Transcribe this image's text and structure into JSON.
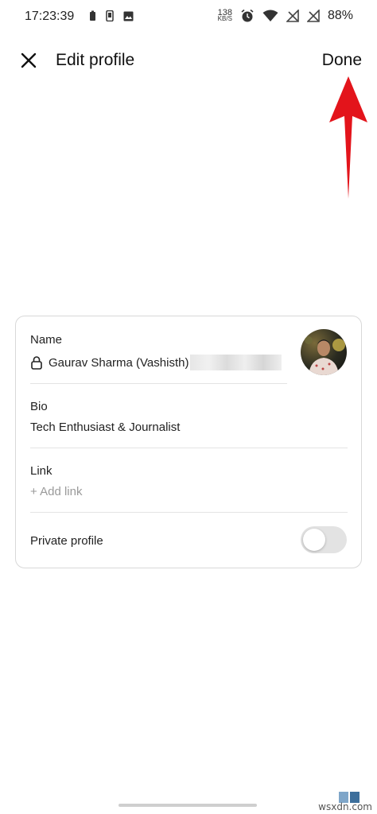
{
  "status_bar": {
    "time": "17:23:39",
    "net_speed_value": "138",
    "net_speed_unit": "KB/S",
    "battery_percent": "88%",
    "icons": [
      "battery-saver-icon",
      "phone-icon",
      "image-icon",
      "alarm-icon",
      "wifi-icon",
      "no-signal-icon",
      "no-signal-icon",
      "battery-icon"
    ]
  },
  "app_bar": {
    "title": "Edit profile",
    "done_label": "Done"
  },
  "profile": {
    "name_label": "Name",
    "name_value": "Gaurav Sharma (Vashisth)",
    "bio_label": "Bio",
    "bio_value": "Tech Enthusiast & Journalist",
    "link_label": "Link",
    "link_placeholder": "+ Add link",
    "private_label": "Private profile",
    "private_enabled": false
  },
  "watermark": "wsxdn.com",
  "colors": {
    "arrow": "#e3141b",
    "toggle_off": "#e3e3e3",
    "card_border": "#d8d8d8"
  }
}
